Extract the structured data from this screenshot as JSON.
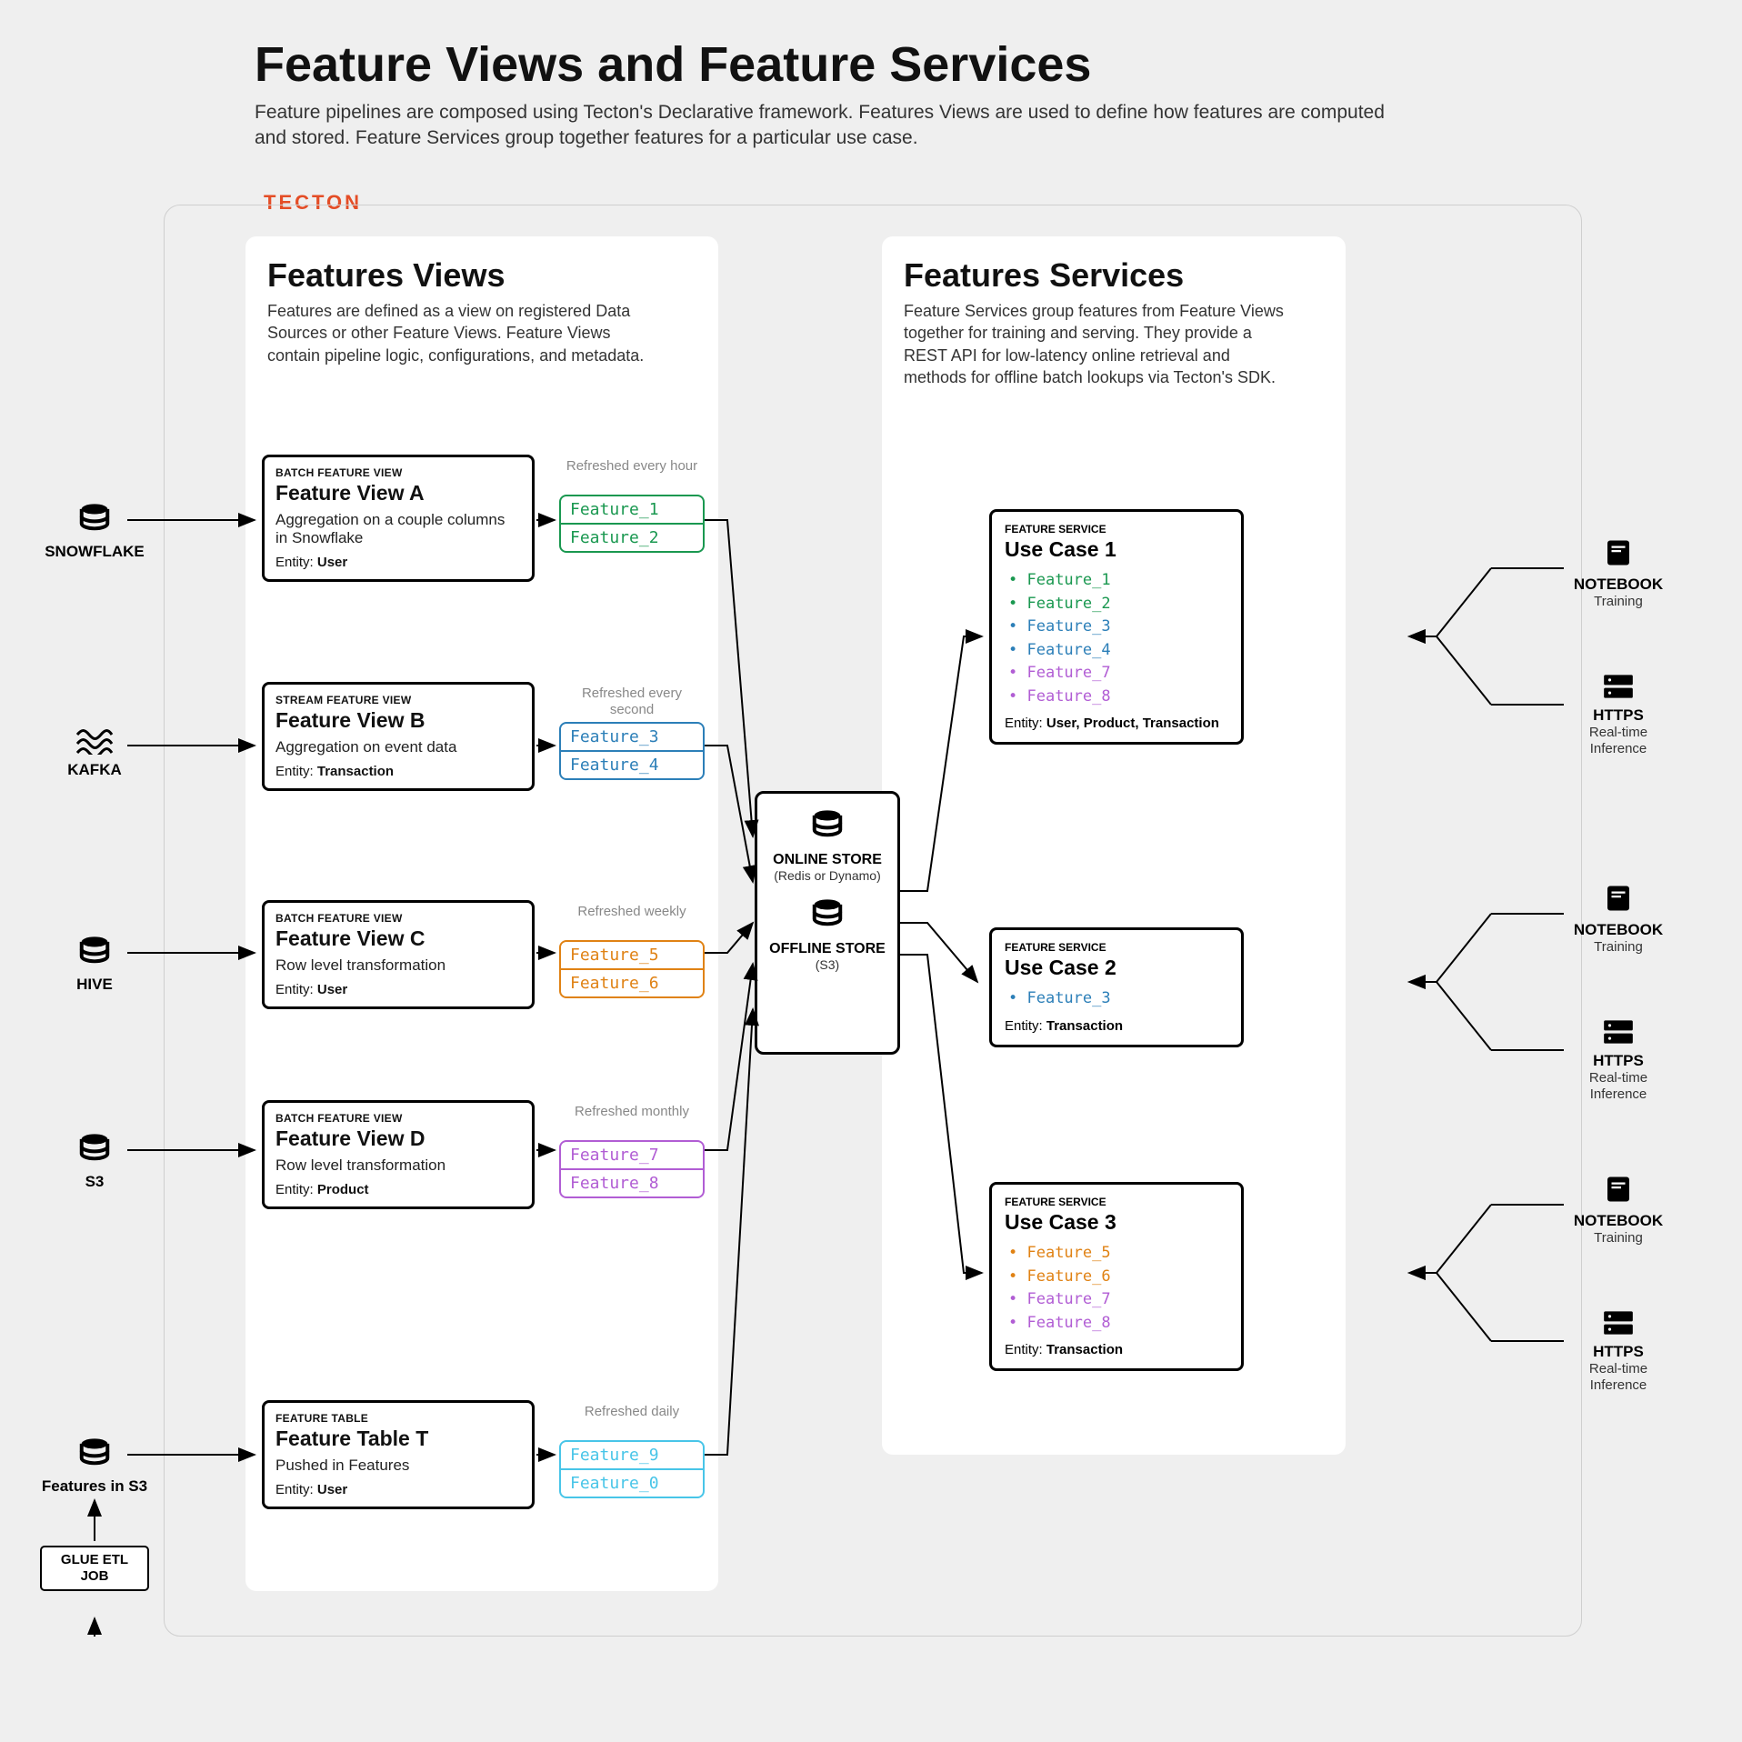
{
  "header": {
    "title": "Feature Views and Feature Services",
    "desc": "Feature pipelines are composed using Tecton's Declarative framework. Features Views are used to define how features are computed and stored. Feature Services group together features for a particular use case."
  },
  "brand": "TECTON",
  "views": {
    "title": "Features Views",
    "desc": "Features are defined as a view on registered Data Sources or other Feature Views. Feature Views contain pipeline logic, configurations, and metadata."
  },
  "services": {
    "title": "Features Services",
    "desc": "Feature Services group features from Feature Views together for training and serving. They provide a REST API for low-latency online retrieval and methods for offline batch lookups via Tecton's SDK."
  },
  "fv": [
    {
      "kind": "BATCH FEATURE VIEW",
      "name": "Feature View A",
      "desc": "Aggregation on a couple columns in Snowflake",
      "entity": "User",
      "refresh": "Refreshed every hour",
      "feats": [
        "Feature_1",
        "Feature_2"
      ],
      "color": "green"
    },
    {
      "kind": "STREAM FEATURE VIEW",
      "name": "Feature View B",
      "desc": "Aggregation on event data",
      "entity": "Transaction",
      "refresh": "Refreshed every second",
      "feats": [
        "Feature_3",
        "Feature_4"
      ],
      "color": "blue"
    },
    {
      "kind": "BATCH FEATURE VIEW",
      "name": "Feature View C",
      "desc": "Row level transformation",
      "entity": "User",
      "refresh": "Refreshed weekly",
      "feats": [
        "Feature_5",
        "Feature_6"
      ],
      "color": "orange"
    },
    {
      "kind": "BATCH FEATURE VIEW",
      "name": "Feature View D",
      "desc": "Row level transformation",
      "entity": "Product",
      "refresh": "Refreshed monthly",
      "feats": [
        "Feature_7",
        "Feature_8"
      ],
      "color": "purple"
    },
    {
      "kind": "FEATURE TABLE",
      "name": "Feature Table T",
      "desc": "Pushed in Features",
      "entity": "User",
      "refresh": "Refreshed daily",
      "feats": [
        "Feature_9",
        "Feature_0"
      ],
      "color": "cyan"
    }
  ],
  "store": {
    "online": "ONLINE STORE",
    "online_sub": "(Redis or Dynamo)",
    "offline": "OFFLINE STORE",
    "offline_sub": "(S3)"
  },
  "svc": [
    {
      "kind": "FEATURE SERVICE",
      "name": "Use Case 1",
      "feats": [
        [
          "Feature_1",
          "green"
        ],
        [
          "Feature_2",
          "green"
        ],
        [
          "Feature_3",
          "blue"
        ],
        [
          "Feature_4",
          "blue"
        ],
        [
          "Feature_7",
          "purple"
        ],
        [
          "Feature_8",
          "purple"
        ]
      ],
      "entity": "User, Product, Transaction"
    },
    {
      "kind": "FEATURE SERVICE",
      "name": "Use Case 2",
      "feats": [
        [
          "Feature_3",
          "blue"
        ]
      ],
      "entity": "Transaction"
    },
    {
      "kind": "FEATURE SERVICE",
      "name": "Use Case 3",
      "feats": [
        [
          "Feature_5",
          "orange"
        ],
        [
          "Feature_6",
          "orange"
        ],
        [
          "Feature_7",
          "purple"
        ],
        [
          "Feature_8",
          "purple"
        ]
      ],
      "entity": "Transaction"
    }
  ],
  "sources": {
    "snowflake": "SNOWFLAKE",
    "kafka": "KAFKA",
    "hive": "HIVE",
    "s3": "S3",
    "fs3": "Features in S3",
    "glue": "GLUE ETL JOB"
  },
  "clients": {
    "notebook": "NOTEBOOK",
    "notebook_sub": "Training",
    "https": "HTTPS",
    "https_sub": "Real-time Inference"
  }
}
